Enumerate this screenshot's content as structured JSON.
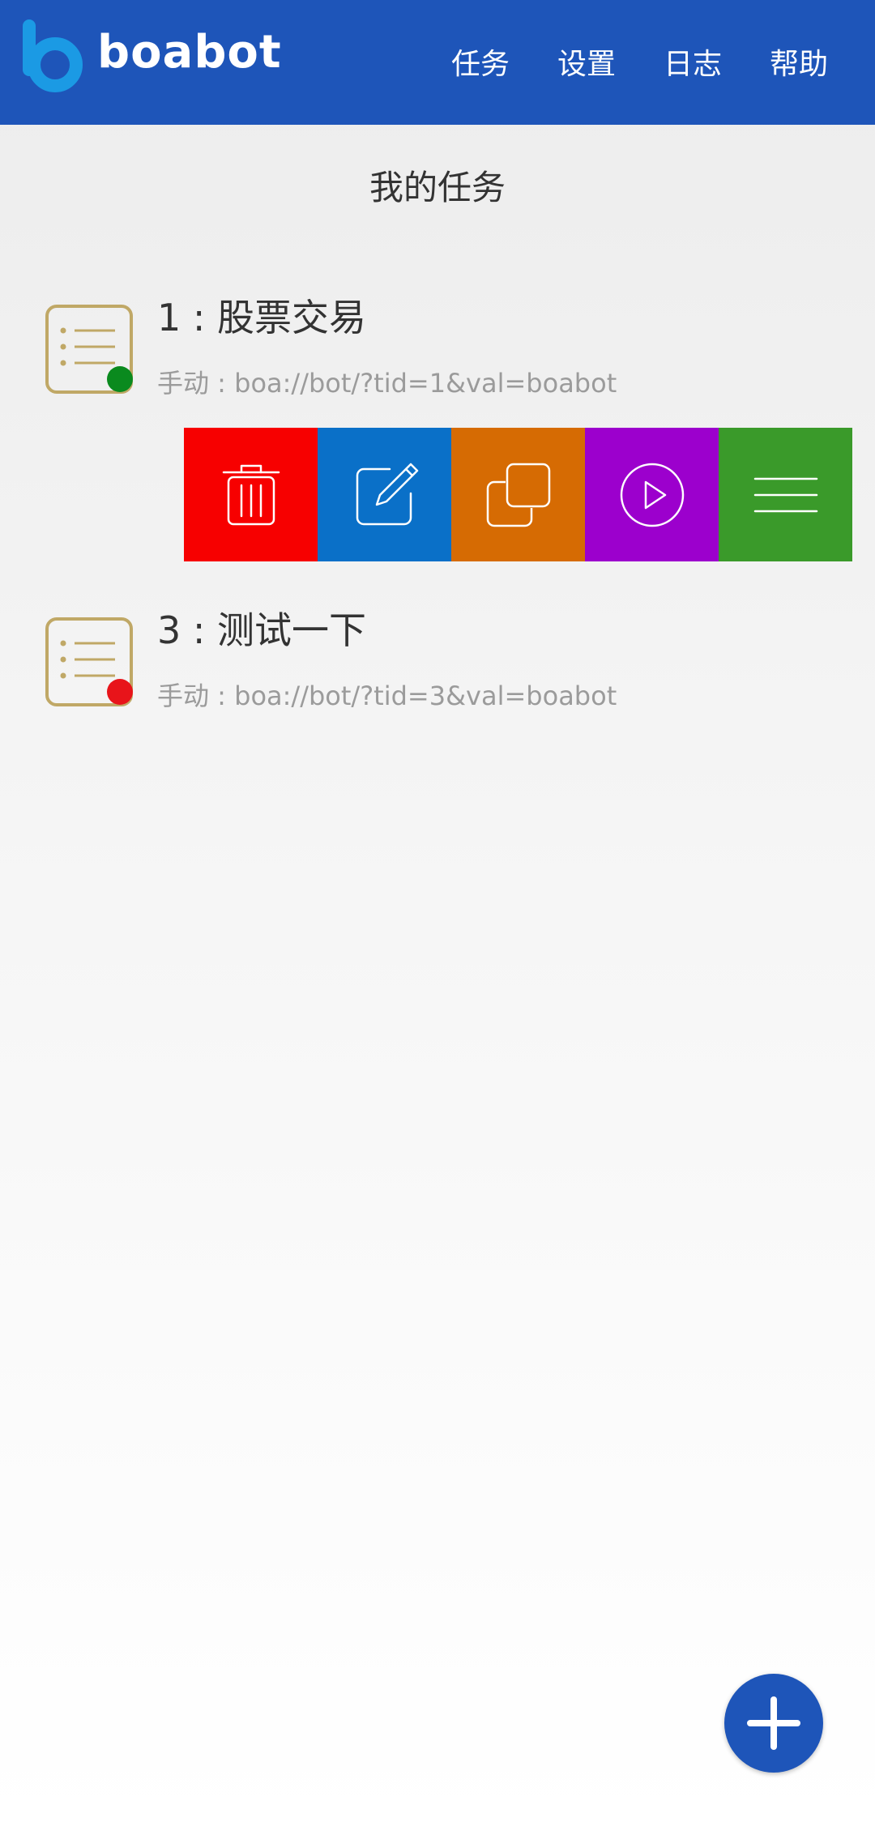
{
  "app": {
    "brand": "boabot"
  },
  "nav": {
    "items": [
      {
        "label": "任务"
      },
      {
        "label": "设置"
      },
      {
        "label": "日志"
      },
      {
        "label": "帮助"
      }
    ]
  },
  "page": {
    "title": "我的任务"
  },
  "tasks": [
    {
      "title": "1 : 股票交易",
      "subtitle": "手动 : boa://bot/?tid=1&val=boabot",
      "status_color": "#0a8a1e"
    },
    {
      "title": "3 : 测试一下",
      "subtitle": "手动 : boa://bot/?tid=3&val=boabot",
      "status_color": "#e8141a"
    }
  ],
  "actions": [
    {
      "icon": "trash-icon",
      "color": "#f70000"
    },
    {
      "icon": "edit-icon",
      "color": "#0a70c8"
    },
    {
      "icon": "copy-icon",
      "color": "#d66b03"
    },
    {
      "icon": "play-icon",
      "color": "#9c00cd"
    },
    {
      "icon": "menu-icon",
      "color": "#3a9a2a"
    }
  ],
  "colors": {
    "header": "#1e55b9",
    "logo": "#1b9ae4",
    "task_icon_border": "#c0a866"
  }
}
